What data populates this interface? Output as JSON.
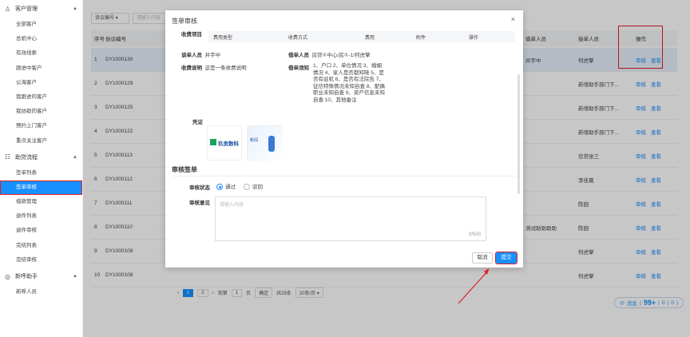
{
  "sidebar": {
    "groups": [
      {
        "icon": "users-icon",
        "label": "客户管理",
        "items": [
          "全部客户",
          "总机中心",
          "有效线索",
          "跟进中客户",
          "公海客户",
          "我跟进的客户",
          "我协助的客户",
          "预约上门客户",
          "重点关注客户"
        ]
      },
      {
        "icon": "flow-icon",
        "label": "助贷流程",
        "items": [
          "签单列表",
          "签单审核",
          "借款管理",
          "退件列表",
          "退件审核",
          "完结列表",
          "完结审核"
        ]
      },
      {
        "icon": "target-icon",
        "label": "新呼助手",
        "items": [
          "新呼人员"
        ]
      }
    ],
    "active_item": "签单审核"
  },
  "filter": {
    "field": "协议编号",
    "placeholder": "请输入内容"
  },
  "table": {
    "headers": {
      "no": "序号",
      "id": "协议编号",
      "p1": "借单人员",
      "p2": "接单人员",
      "op": "操作"
    },
    "rows": [
      {
        "no": "1",
        "id": "DY1000130",
        "p1": "井宇中",
        "p2": "何虎擎"
      },
      {
        "no": "2",
        "id": "DY1000129",
        "p1": "",
        "p2": "新增助手部门下..."
      },
      {
        "no": "3",
        "id": "DY1000125",
        "p1": "",
        "p2": "新增助手部门下..."
      },
      {
        "no": "4",
        "id": "DY1000122",
        "p1": "",
        "p2": "新增助手部门下..."
      },
      {
        "no": "5",
        "id": "DY1000113",
        "p1": "",
        "p2": "信贷张三"
      },
      {
        "no": "6",
        "id": "DY1000112",
        "p1": "",
        "p2": "李佳晨"
      },
      {
        "no": "7",
        "id": "DY1000111",
        "p1": "",
        "p2": "陈园"
      },
      {
        "no": "8",
        "id": "DY1000110",
        "p1": "测试助助助助",
        "p2": "陈园"
      },
      {
        "no": "9",
        "id": "DY1000109",
        "p1": "",
        "p2": "何虎擎"
      },
      {
        "no": "10",
        "id": "DY1000108",
        "p1": "",
        "p2": "何虎擎"
      }
    ],
    "op_review": "审核",
    "op_view": "查看"
  },
  "pager": {
    "pages": [
      "1",
      "2"
    ],
    "goto": "到第",
    "page_input": "1",
    "page_unit": "页",
    "confirm": "确定",
    "total": "共29条",
    "per_page": "20条/页"
  },
  "status_pill": {
    "label": "消息",
    "count": "99+",
    "a": "0",
    "b": "0"
  },
  "modal": {
    "title": "签单审核",
    "charge_label": "收费项目",
    "sub_headers": [
      "费用类型",
      "收费方式",
      "费用",
      "附件",
      "操作"
    ],
    "signer_label": "谈单人员",
    "signer_value": "井宇中",
    "borrower_label": "借单人员",
    "borrower_value": "房贷①中心/房①-1/何虎擎",
    "desc_label": "收费说明",
    "desc_value": "这是一条收费说明",
    "notice_label": "借单须知",
    "notice_value": "1、户口 2、单位情况 3、婚姻情况 4、家人是否都知晓 5、是否有驻机 6、是否有法院告 7、征信特殊情况未知自查 8、配偶职业未知自查 9、资产信息未知自查 10、其他备注",
    "voucher_label": "凭证",
    "attach1_text": "玖贡数科",
    "attach2_text": "新闻",
    "section": "审核签单",
    "status_label": "审核状态",
    "opt_pass": "通过",
    "opt_reject": "驳回",
    "opinion_label": "审核意见",
    "opinion_placeholder": "请输入内容",
    "counter": "0/500",
    "cancel": "取消",
    "submit": "提交"
  },
  "colors": {
    "primary": "#1890ff",
    "highlight": "#e02020"
  }
}
